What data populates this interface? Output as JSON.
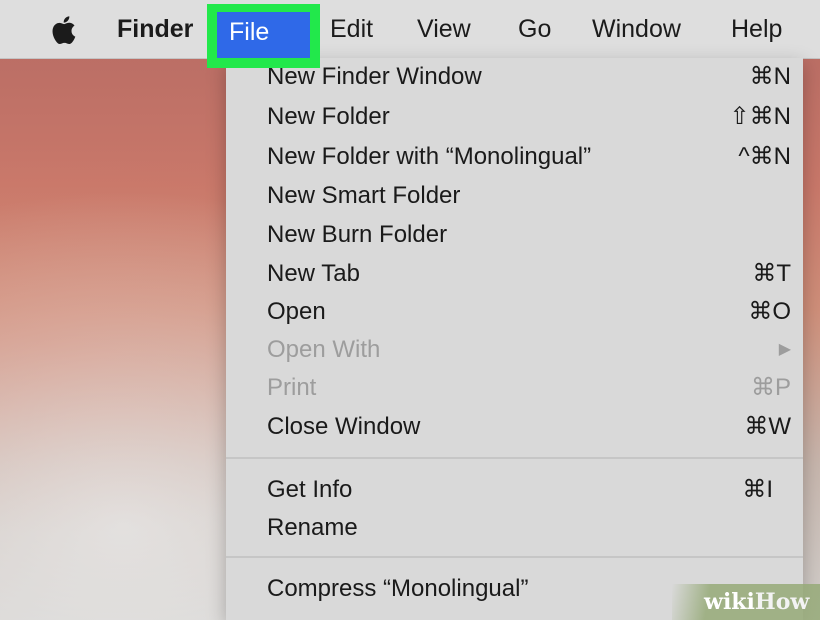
{
  "menubar": {
    "apple_icon": "apple-logo",
    "app_name": "Finder",
    "menus": [
      "File",
      "Edit",
      "View",
      "Go",
      "Window",
      "Help"
    ]
  },
  "highlight_color": "#22e84b",
  "selected_menu_color": "#2f69e8",
  "file_menu": {
    "items": [
      {
        "label": "New Finder Window",
        "shortcut": "⌘N",
        "enabled": true
      },
      {
        "label": "New Folder",
        "shortcut": "⇧⌘N",
        "enabled": true
      },
      {
        "label": "New Folder with “Monolingual”",
        "shortcut": "^⌘N",
        "enabled": true
      },
      {
        "label": "New Smart Folder",
        "shortcut": "",
        "enabled": true
      },
      {
        "label": "New Burn Folder",
        "shortcut": "",
        "enabled": true
      },
      {
        "label": "New Tab",
        "shortcut": "⌘T",
        "enabled": true
      },
      {
        "label": "Open",
        "shortcut": "⌘O",
        "enabled": true
      },
      {
        "label": "Open With",
        "shortcut": "▶",
        "enabled": false
      },
      {
        "label": "Print",
        "shortcut": "⌘P",
        "enabled": false
      },
      {
        "label": "Close Window",
        "shortcut": "⌘W",
        "enabled": true
      },
      {
        "label": "Get Info",
        "shortcut": "⌘I",
        "enabled": true
      },
      {
        "label": "Rename",
        "shortcut": "",
        "enabled": true
      },
      {
        "label": "Compress “Monolingual”",
        "shortcut": "",
        "enabled": true
      }
    ]
  },
  "watermark": {
    "part1": "wiki",
    "part2": "How"
  }
}
